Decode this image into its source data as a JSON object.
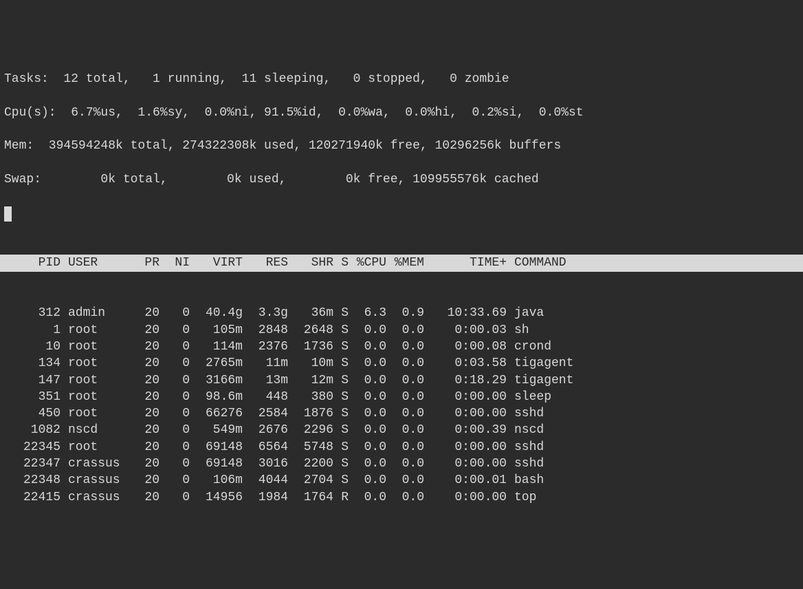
{
  "summary": {
    "tasks": "Tasks:  12 total,   1 running,  11 sleeping,   0 stopped,   0 zombie",
    "cpu": "Cpu(s):  6.7%us,  1.6%sy,  0.0%ni, 91.5%id,  0.0%wa,  0.0%hi,  0.2%si,  0.0%st",
    "mem": "Mem:  394594248k total, 274322308k used, 120271940k free, 10296256k buffers",
    "swap": "Swap:        0k total,        0k used,        0k free, 109955576k cached"
  },
  "columns": {
    "pid": "PID",
    "user": "USER",
    "pr": "PR",
    "ni": "NI",
    "virt": "VIRT",
    "res": "RES",
    "shr": "SHR",
    "s": "S",
    "cpu": "%CPU",
    "mem": "%MEM",
    "time": "TIME+",
    "cmd": "COMMAND"
  },
  "processes": [
    {
      "pid": "312",
      "user": "admin",
      "pr": "20",
      "ni": "0",
      "virt": "40.4g",
      "res": "3.3g",
      "shr": "36m",
      "s": "S",
      "cpu": "6.3",
      "mem": "0.9",
      "time": "10:33.69",
      "cmd": "java"
    },
    {
      "pid": "1",
      "user": "root",
      "pr": "20",
      "ni": "0",
      "virt": "105m",
      "res": "2848",
      "shr": "2648",
      "s": "S",
      "cpu": "0.0",
      "mem": "0.0",
      "time": "0:00.03",
      "cmd": "sh"
    },
    {
      "pid": "10",
      "user": "root",
      "pr": "20",
      "ni": "0",
      "virt": "114m",
      "res": "2376",
      "shr": "1736",
      "s": "S",
      "cpu": "0.0",
      "mem": "0.0",
      "time": "0:00.08",
      "cmd": "crond"
    },
    {
      "pid": "134",
      "user": "root",
      "pr": "20",
      "ni": "0",
      "virt": "2765m",
      "res": "11m",
      "shr": "10m",
      "s": "S",
      "cpu": "0.0",
      "mem": "0.0",
      "time": "0:03.58",
      "cmd": "tigagent"
    },
    {
      "pid": "147",
      "user": "root",
      "pr": "20",
      "ni": "0",
      "virt": "3166m",
      "res": "13m",
      "shr": "12m",
      "s": "S",
      "cpu": "0.0",
      "mem": "0.0",
      "time": "0:18.29",
      "cmd": "tigagent"
    },
    {
      "pid": "351",
      "user": "root",
      "pr": "20",
      "ni": "0",
      "virt": "98.6m",
      "res": "448",
      "shr": "380",
      "s": "S",
      "cpu": "0.0",
      "mem": "0.0",
      "time": "0:00.00",
      "cmd": "sleep"
    },
    {
      "pid": "450",
      "user": "root",
      "pr": "20",
      "ni": "0",
      "virt": "66276",
      "res": "2584",
      "shr": "1876",
      "s": "S",
      "cpu": "0.0",
      "mem": "0.0",
      "time": "0:00.00",
      "cmd": "sshd"
    },
    {
      "pid": "1082",
      "user": "nscd",
      "pr": "20",
      "ni": "0",
      "virt": "549m",
      "res": "2676",
      "shr": "2296",
      "s": "S",
      "cpu": "0.0",
      "mem": "0.0",
      "time": "0:00.39",
      "cmd": "nscd"
    },
    {
      "pid": "22345",
      "user": "root",
      "pr": "20",
      "ni": "0",
      "virt": "69148",
      "res": "6564",
      "shr": "5748",
      "s": "S",
      "cpu": "0.0",
      "mem": "0.0",
      "time": "0:00.00",
      "cmd": "sshd"
    },
    {
      "pid": "22347",
      "user": "crassus",
      "pr": "20",
      "ni": "0",
      "virt": "69148",
      "res": "3016",
      "shr": "2200",
      "s": "S",
      "cpu": "0.0",
      "mem": "0.0",
      "time": "0:00.00",
      "cmd": "sshd"
    },
    {
      "pid": "22348",
      "user": "crassus",
      "pr": "20",
      "ni": "0",
      "virt": "106m",
      "res": "4044",
      "shr": "2704",
      "s": "S",
      "cpu": "0.0",
      "mem": "0.0",
      "time": "0:00.01",
      "cmd": "bash"
    },
    {
      "pid": "22415",
      "user": "crassus",
      "pr": "20",
      "ni": "0",
      "virt": "14956",
      "res": "1984",
      "shr": "1764",
      "s": "R",
      "cpu": "0.0",
      "mem": "0.0",
      "time": "0:00.00",
      "cmd": "top"
    }
  ]
}
